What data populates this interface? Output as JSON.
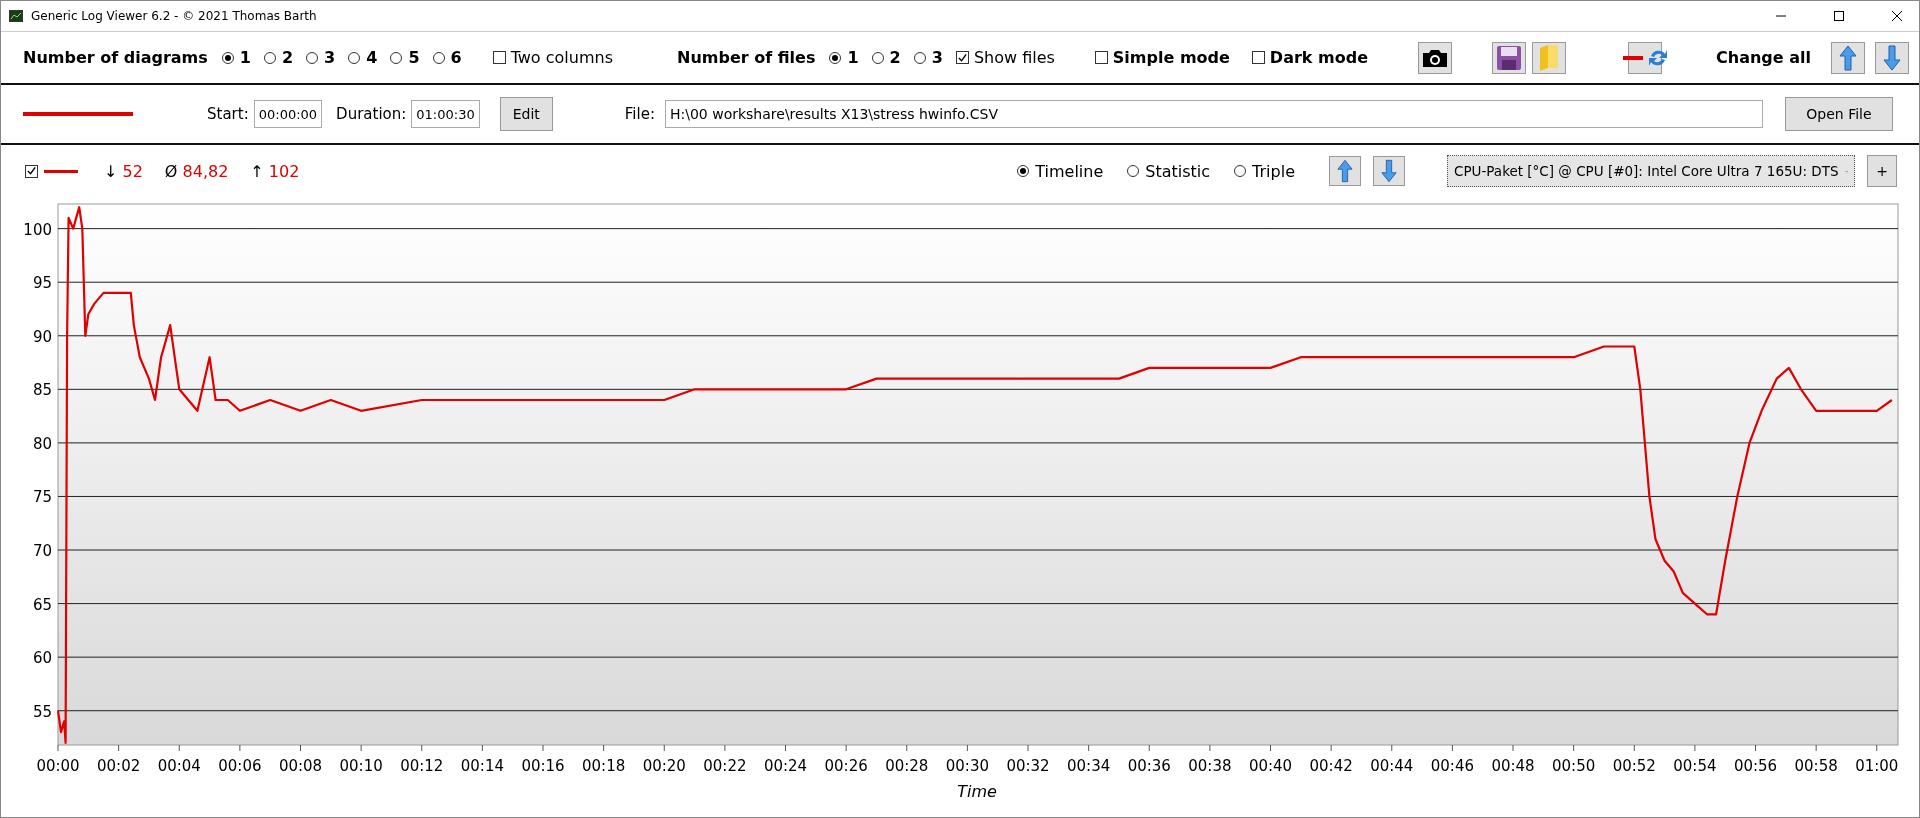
{
  "window": {
    "title": "Generic Log Viewer 6.2 - © 2021 Thomas Barth"
  },
  "toolbar": {
    "diagrams_label": "Number of diagrams",
    "diagram_options": [
      {
        "label": "1",
        "selected": true
      },
      {
        "label": "2",
        "selected": false
      },
      {
        "label": "3",
        "selected": false
      },
      {
        "label": "4",
        "selected": false
      },
      {
        "label": "5",
        "selected": false
      },
      {
        "label": "6",
        "selected": false
      }
    ],
    "two_columns": {
      "label": "Two columns",
      "checked": false
    },
    "files_label": "Number of files",
    "file_options": [
      {
        "label": "1",
        "selected": true
      },
      {
        "label": "2",
        "selected": false
      },
      {
        "label": "3",
        "selected": false
      }
    ],
    "show_files": {
      "label": "Show files",
      "checked": true
    },
    "simple_mode": {
      "label": "Simple mode",
      "checked": false
    },
    "dark_mode": {
      "label": "Dark mode",
      "checked": false
    },
    "change_all_label": "Change all"
  },
  "file_row": {
    "start_label": "Start:",
    "start": "00:00:00",
    "duration_label": "Duration:",
    "duration": "01:00:30",
    "edit_button": "Edit",
    "file_label": "File:",
    "file_path": "H:\\00 workshare\\results X13\\stress hwinfo.CSV",
    "open_button": "Open File"
  },
  "diagram": {
    "visible": true,
    "min_symbol": "↓",
    "min": "52",
    "avg_symbol": "Ø",
    "avg": "84,82",
    "max_symbol": "↑",
    "max": "102",
    "views": [
      {
        "label": "Timeline",
        "selected": true
      },
      {
        "label": "Statistic",
        "selected": false
      },
      {
        "label": "Triple",
        "selected": false
      }
    ],
    "channel": "CPU-Paket [°C] @ CPU [#0]: Intel Core Ultra 7 165U: DTS",
    "add_button": "+",
    "chart_data": {
      "type": "line",
      "xlabel": "Time",
      "grid": true,
      "xlim": [
        0,
        60.7
      ],
      "ylim": [
        51.8,
        102.3
      ],
      "yticks": [
        55,
        60,
        65,
        70,
        75,
        80,
        85,
        90,
        95,
        100
      ],
      "xticks": [
        {
          "value": 0,
          "label": "00:00"
        },
        {
          "value": 2,
          "label": "00:02"
        },
        {
          "value": 4,
          "label": "00:04"
        },
        {
          "value": 6,
          "label": "00:06"
        },
        {
          "value": 8,
          "label": "00:08"
        },
        {
          "value": 10,
          "label": "00:10"
        },
        {
          "value": 12,
          "label": "00:12"
        },
        {
          "value": 14,
          "label": "00:14"
        },
        {
          "value": 16,
          "label": "00:16"
        },
        {
          "value": 18,
          "label": "00:18"
        },
        {
          "value": 20,
          "label": "00:20"
        },
        {
          "value": 22,
          "label": "00:22"
        },
        {
          "value": 24,
          "label": "00:24"
        },
        {
          "value": 26,
          "label": "00:26"
        },
        {
          "value": 28,
          "label": "00:28"
        },
        {
          "value": 30,
          "label": "00:30"
        },
        {
          "value": 32,
          "label": "00:32"
        },
        {
          "value": 34,
          "label": "00:34"
        },
        {
          "value": 36,
          "label": "00:36"
        },
        {
          "value": 38,
          "label": "00:38"
        },
        {
          "value": 40,
          "label": "00:40"
        },
        {
          "value": 42,
          "label": "00:42"
        },
        {
          "value": 44,
          "label": "00:44"
        },
        {
          "value": 46,
          "label": "00:46"
        },
        {
          "value": 48,
          "label": "00:48"
        },
        {
          "value": 50,
          "label": "00:50"
        },
        {
          "value": 52,
          "label": "00:52"
        },
        {
          "value": 54,
          "label": "00:54"
        },
        {
          "value": 56,
          "label": "00:56"
        },
        {
          "value": 58,
          "label": "00:58"
        },
        {
          "value": 60,
          "label": "01:00"
        }
      ],
      "x": [
        0,
        0.1,
        0.2,
        0.25,
        0.3,
        0.35,
        0.5,
        0.6,
        0.7,
        0.8,
        0.9,
        1.0,
        1.2,
        1.5,
        2.0,
        2.4,
        2.5,
        2.7,
        3.0,
        3.2,
        3.4,
        3.7,
        3.9,
        4.0,
        4.3,
        4.6,
        5.0,
        5.2,
        5.6,
        6,
        7,
        8,
        9,
        10,
        12,
        14,
        16,
        18,
        20,
        21,
        22,
        24,
        26,
        27,
        28,
        30,
        31,
        34,
        35,
        36,
        38,
        40,
        41,
        44,
        48,
        50,
        51,
        52,
        52.2,
        52.5,
        52.7,
        53,
        53.3,
        53.6,
        54,
        54.4,
        54.7,
        55,
        55.4,
        55.8,
        56.2,
        56.7,
        57.1,
        57.5,
        58,
        59,
        60,
        60.5
      ],
      "series": [
        {
          "color": "#e00000",
          "values": [
            55,
            53,
            54,
            52,
            90,
            101,
            100,
            101,
            102,
            100,
            90,
            92,
            93,
            94,
            94,
            94,
            91,
            88,
            86,
            84,
            88,
            91,
            87,
            85,
            84,
            83,
            88,
            84,
            84,
            83,
            84,
            83,
            84,
            83,
            84,
            84,
            84,
            84,
            84,
            85,
            85,
            85,
            85,
            86,
            86,
            86,
            86,
            86,
            86,
            87,
            87,
            87,
            88,
            88,
            88,
            88,
            89,
            89,
            85,
            75,
            71,
            69,
            68,
            66,
            65,
            64,
            64,
            69,
            75,
            80,
            83,
            86,
            87,
            85,
            83,
            83,
            83,
            84
          ]
        }
      ]
    }
  }
}
